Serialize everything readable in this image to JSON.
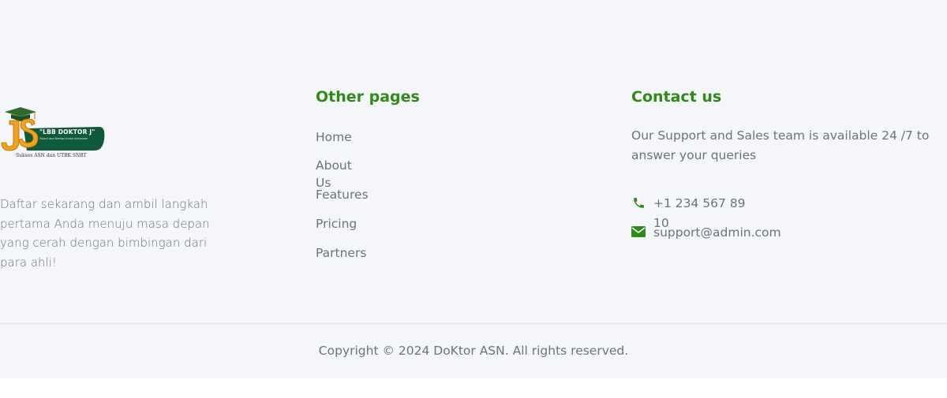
{
  "logo": {
    "banner_text": "\"LBB DOKTOR J\"",
    "banner_subtext": "Tryout and Bimbel Untuk Kelulusan",
    "caption": "Sukses ASN dan UTBK SNBT"
  },
  "about": {
    "text": "Daftar sekarang dan ambil langkah pertama Anda menuju masa depan yang cerah dengan bimbingan dari para ahli!"
  },
  "pages": {
    "title": "Other pages",
    "items": [
      {
        "label": "Home"
      },
      {
        "label": "About Us"
      },
      {
        "label": "Features"
      },
      {
        "label": "Pricing"
      },
      {
        "label": "Partners"
      }
    ]
  },
  "contact": {
    "title": "Contact us",
    "description": "Our Support and Sales team is available 24 /7 to answer your queries",
    "phone": "+1 234 567 89 10",
    "email": "support@admin.com",
    "accent_color": "#2f8a1a"
  },
  "footer": {
    "copyright": "Copyright © 2024 DoKtor ASN. All rights reserved."
  }
}
